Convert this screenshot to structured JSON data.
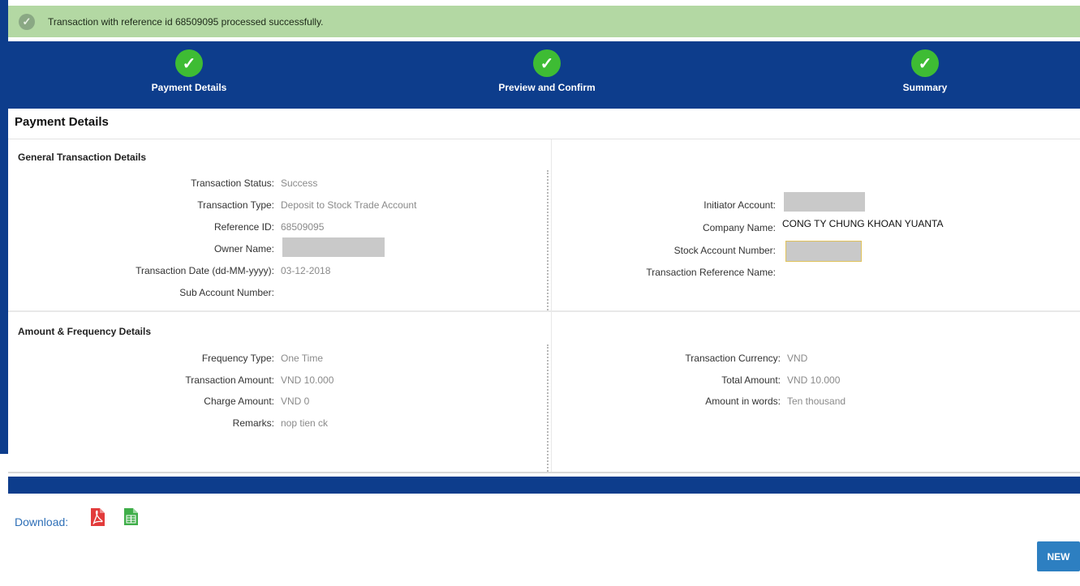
{
  "banner": {
    "message": "Transaction with reference id 68509095 processed successfully.",
    "icon": "check-circle-icon"
  },
  "steps": [
    {
      "label": "Payment Details",
      "icon": "check-icon",
      "status": "done"
    },
    {
      "label": "Preview and Confirm",
      "icon": "check-icon",
      "status": "done"
    },
    {
      "label": "Summary",
      "icon": "check-icon",
      "status": "done"
    }
  ],
  "page_title": "Payment Details",
  "general": {
    "title": "General Transaction Details",
    "left": [
      {
        "label": "Transaction Status:",
        "value": "Success"
      },
      {
        "label": "Transaction Type:",
        "value": "Deposit to Stock Trade Account"
      },
      {
        "label": "Reference ID:",
        "value": "68509095"
      },
      {
        "label": "Owner Name:",
        "value": "",
        "redacted": true
      },
      {
        "label": "Transaction Date (dd-MM-yyyy):",
        "value": "03-12-2018"
      },
      {
        "label": "Sub Account Number:",
        "value": ""
      }
    ],
    "right": [
      {
        "label": "Initiator Account:",
        "value": "",
        "redacted": true
      },
      {
        "label": "Company Name:",
        "value": "CONG TY CHUNG KHOAN YUANTA"
      },
      {
        "label": "Stock Account Number:",
        "value": "",
        "redacted": true
      },
      {
        "label": "Transaction Reference Name:",
        "value": ""
      }
    ]
  },
  "amount": {
    "title": "Amount & Frequency Details",
    "left": [
      {
        "label": "Frequency Type:",
        "value": "One Time"
      },
      {
        "label": "Transaction Amount:",
        "value": "VND 10.000"
      },
      {
        "label": "Charge Amount:",
        "value": "VND 0"
      },
      {
        "label": "Remarks:",
        "value": "nop tien ck"
      }
    ],
    "right": [
      {
        "label": "Transaction Currency:",
        "value": "VND"
      },
      {
        "label": "Total Amount:",
        "value": "VND 10.000"
      },
      {
        "label": "Amount in words:",
        "value": "Ten thousand"
      }
    ]
  },
  "download": {
    "label": "Download:",
    "pdf_icon": "pdf-icon",
    "excel_icon": "excel-icon"
  },
  "new_button": "NEW",
  "colors": {
    "header_blue": "#0d3d8c",
    "success_banner": "#b3d8a3",
    "step_green": "#3ebc34",
    "button_blue": "#2d7fc1",
    "link_blue": "#2e6fb7"
  }
}
